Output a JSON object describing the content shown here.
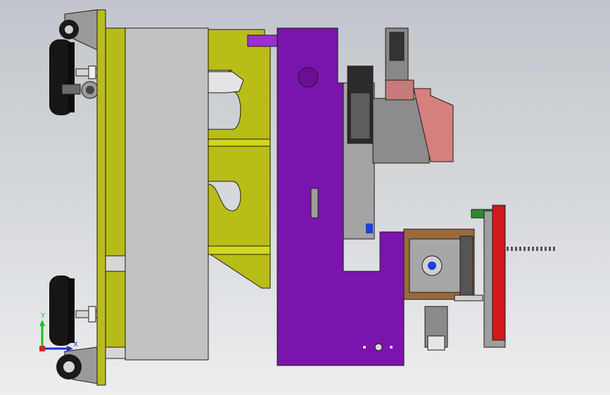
{
  "viewport": {
    "background_top": "#c2c6cc",
    "background_bottom": "#eceef0"
  },
  "colors": {
    "frame_yellow": "#b9bd18",
    "frame_yellow_dark": "#8e9210",
    "purple_body": "#7b14ad",
    "purple_dark": "#4d0a70",
    "gray_block": "#c0c0c0",
    "brown_plate": "#9b6a3b",
    "motor_gray": "#8a8a8a",
    "salmon_gear": "#d67f7f",
    "red_belt": "#d11a1a",
    "green_link": "#2f8a2f",
    "black_wheel": "#161616",
    "axis_y_color": "#1fbf1f",
    "axis_x_color": "#1f2fd8"
  },
  "triad": {
    "y_label": "Y",
    "x_label": "X"
  }
}
